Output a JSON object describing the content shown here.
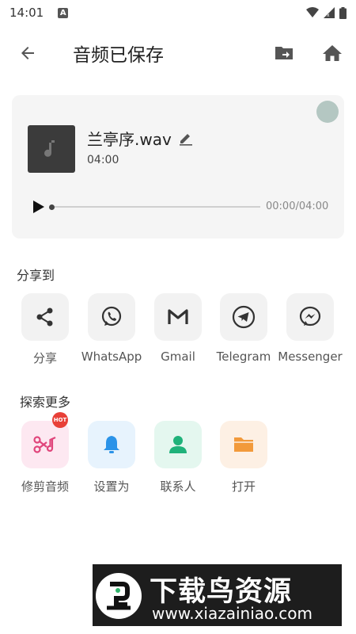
{
  "status_bar": {
    "time": "14:01",
    "notification": "A"
  },
  "app_bar": {
    "title": "音频已保存"
  },
  "card": {
    "file_name": "兰亭序.wav",
    "duration": "04:00",
    "time_readout": "00:00/04:00",
    "progress": 0
  },
  "share": {
    "title": "分享到",
    "items": [
      {
        "label": "分享",
        "icon": "share-icon"
      },
      {
        "label": "WhatsApp",
        "icon": "whatsapp-icon"
      },
      {
        "label": "Gmail",
        "icon": "gmail-icon"
      },
      {
        "label": "Telegram",
        "icon": "telegram-icon"
      },
      {
        "label": "Messenger",
        "icon": "messenger-icon"
      }
    ]
  },
  "explore": {
    "title": "探索更多",
    "badge": "HOT",
    "items": [
      {
        "label": "修剪音频",
        "icon": "trim-audio-icon",
        "bg": "#fde8f1",
        "color": "#e0457b"
      },
      {
        "label": "设置为",
        "icon": "bell-icon",
        "bg": "#e7f3fd",
        "color": "#2b93e8"
      },
      {
        "label": "联系人",
        "icon": "contact-icon",
        "bg": "#e4f7ef",
        "color": "#1fb27a"
      },
      {
        "label": "打开",
        "icon": "folder-icon",
        "bg": "#fdf0e4",
        "color": "#f29a3b"
      }
    ]
  },
  "watermark": {
    "title": "下载鸟资源",
    "url": "www.xiazainiao.com"
  }
}
